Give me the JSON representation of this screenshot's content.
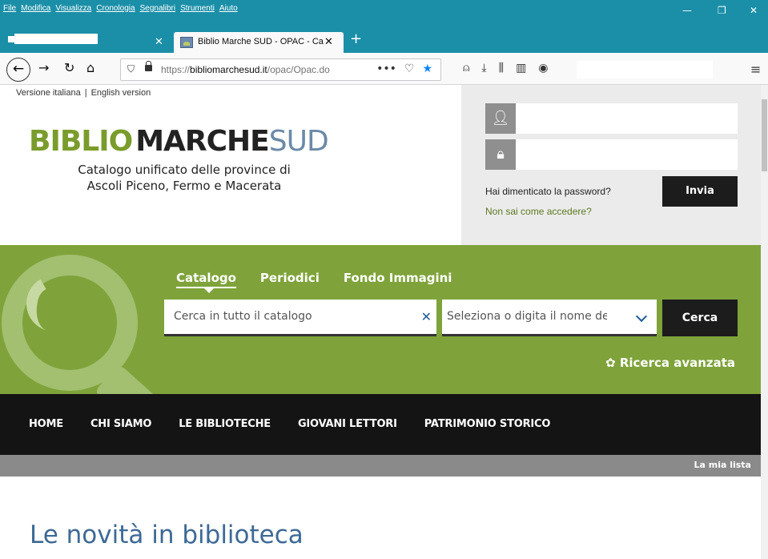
{
  "browser": {
    "menu": [
      "File",
      "Modifica",
      "Visualizza",
      "Cronologia",
      "Segnalibri",
      "Strumenti",
      "Aiuto"
    ],
    "window_controls": {
      "minimize": "—",
      "restore": "❐",
      "close": "✕"
    },
    "tab_active_title": "Biblio Marche SUD - OPAC - Ca",
    "url_prefix": "https://",
    "url_domain": "bibliomarchesud.it",
    "url_path": "/opac/Opac.do",
    "url_dots": "•••"
  },
  "page": {
    "lang_it": "Versione italiana",
    "lang_sep": "|",
    "lang_en": "English version",
    "logo": {
      "part1": "BIBLIO",
      "part2": "MARCHE",
      "part3": "SUD"
    },
    "tagline_line1": "Catalogo unificato delle province di",
    "tagline_line2": "Ascoli Piceno, Fermo e Macerata",
    "login": {
      "forgot": "Hai dimenticato la password?",
      "howto": "Non sai come accedere?",
      "submit": "Invia"
    },
    "search": {
      "tabs": [
        "Catalogo",
        "Periodici",
        "Fondo Immagini"
      ],
      "placeholder": "Cerca in tutto il catalogo",
      "select_placeholder": "Seleziona o digita il nome della",
      "button": "Cerca",
      "advanced": "Ricerca avanzata"
    },
    "nav": [
      "HOME",
      "CHI SIAMO",
      "LE BIBLIOTECHE",
      "GIOVANI LETTORI",
      "PATRIMONIO STORICO"
    ],
    "my_list": "La mia lista",
    "heading": "Le novità in biblioteca"
  },
  "colors": {
    "brand_green": "#7fa33a",
    "titlebar": "#1b8fa8",
    "heading_blue": "#3d6a96"
  }
}
